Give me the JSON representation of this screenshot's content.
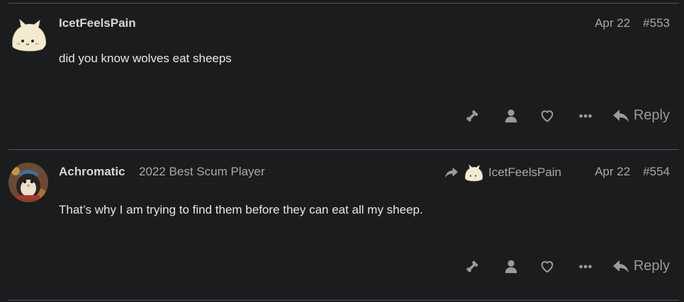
{
  "posts": [
    {
      "username": "IcetFeelsPain",
      "user_title": "",
      "date": "Apr 22",
      "post_number": "#553",
      "body": "did you know wolves eat sheeps",
      "reply_to": null,
      "avatar_icon": "cat-dumpling-avatar"
    },
    {
      "username": "Achromatic",
      "user_title": "2022 Best Scum Player",
      "date": "Apr 22",
      "post_number": "#554",
      "body": "That’s why I am trying to find them before they can eat all my sheep.",
      "reply_to": {
        "username": "IcetFeelsPain",
        "icon": "reply-arrow-icon"
      },
      "avatar_icon": "penguin-avatar"
    }
  ],
  "actions": {
    "reply_label": "Reply",
    "icons": [
      "gavel-icon",
      "user-icon",
      "heart-icon",
      "ellipsis-icon",
      "reply-icon"
    ]
  },
  "colors": {
    "background": "#1b1c1e",
    "divider": "#56565a",
    "muted_text": "#a8a8a8",
    "icon": "#9a9a9a"
  }
}
